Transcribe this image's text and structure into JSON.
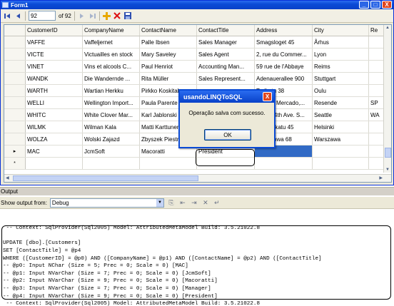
{
  "window": {
    "title": "Form1",
    "min_label": "_",
    "max_label": "□",
    "close_label": "X"
  },
  "navigator": {
    "position": "92",
    "count_label": "of 92"
  },
  "grid": {
    "columns": [
      "CustomerID",
      "CompanyName",
      "ContactName",
      "ContactTitle",
      "Address",
      "City",
      "Re"
    ],
    "rows": [
      {
        "indicator": "",
        "cells": [
          "VAFFE",
          "Vaffeljernet",
          "Palle Ibsen",
          "Sales Manager",
          "Smagsloget 45",
          "Århus",
          ""
        ]
      },
      {
        "indicator": "",
        "cells": [
          "VICTE",
          "Victuailles en stock",
          "Mary Saveley",
          "Sales Agent",
          "2, rue du Commer...",
          "Lyon",
          ""
        ]
      },
      {
        "indicator": "",
        "cells": [
          "VINET",
          "Vins et alcools C...",
          "Paul Henriot",
          "Accounting Man...",
          "59 rue de l'Abbaye",
          "Reims",
          ""
        ]
      },
      {
        "indicator": "",
        "cells": [
          "WANDK",
          "Die Wandernde ...",
          "Rita Müller",
          "Sales Represent...",
          "Adenauerallee 900",
          "Stuttgart",
          ""
        ]
      },
      {
        "indicator": "",
        "cells": [
          "WARTH",
          "Wartian Herkku",
          "Pirkko Koskitalo",
          "",
          "Torikatu 38",
          "Oulu",
          ""
        ]
      },
      {
        "indicator": "",
        "cells": [
          "WELLI",
          "Wellington Import...",
          "Paula Parente",
          "",
          "Rua do Mercado,...",
          "Resende",
          "SP"
        ]
      },
      {
        "indicator": "",
        "cells": [
          "WHITC",
          "White Clover Mar...",
          "Karl Jablonski",
          "",
          "305 - 14th Ave. S...",
          "Seattle",
          "WA"
        ]
      },
      {
        "indicator": "",
        "cells": [
          "WILMK",
          "Wilman Kala",
          "Matti Karttunen",
          "",
          "Keskuskatu 45",
          "Helsinki",
          ""
        ]
      },
      {
        "indicator": "",
        "cells": [
          "WOLZA",
          "Wolski  Zajazd",
          "Zbyszek Piestrzeniewicz",
          "",
          "ul. Filtrowa 68",
          "Warszawa",
          ""
        ]
      },
      {
        "indicator": "▸",
        "cells": [
          "MAC",
          "JcmSoft",
          "Macoratti",
          "President",
          "",
          "",
          ""
        ]
      },
      {
        "indicator": "*",
        "cells": [
          "",
          "",
          "",
          "",
          "",
          "",
          ""
        ]
      }
    ]
  },
  "dialog": {
    "title": "usandoLINQToSQL",
    "close_label": "X",
    "message": "Operação salva com sucesso.",
    "ok_label": "OK"
  },
  "output": {
    "title": "Output",
    "show_label": "Show output from:",
    "source": "Debug",
    "lines": [
      " -- Context: SqlProvider(Sql2005) Model: AttributedMetaModel Build: 3.5.21022.8",
      "",
      "UPDATE [dbo].[Customers]",
      "SET [ContactTitle] = @p4",
      "WHERE ([CustomerID] = @p0) AND ([CompanyName] = @p1) AND ([ContactName] = @p2) AND ([ContactTitle]",
      "-- @p0: Input NChar (Size = 5; Prec = 0; Scale = 0) [MAC]",
      "-- @p1: Input NVarChar (Size = 7; Prec = 0; Scale = 0) [JcmSoft]",
      "-- @p2: Input NVarChar (Size = 9; Prec = 0; Scale = 0) [Macoratti]",
      "-- @p3: Input NVarChar (Size = 7; Prec = 0; Scale = 0) [Manager]",
      "-- @p4: Input NVarChar (Size = 9; Prec = 0; Scale = 0) [President]",
      " -- Context: SqlProvider(Sql2005) Model: AttributedMetaModel Build: 3.5.21022.8"
    ]
  }
}
